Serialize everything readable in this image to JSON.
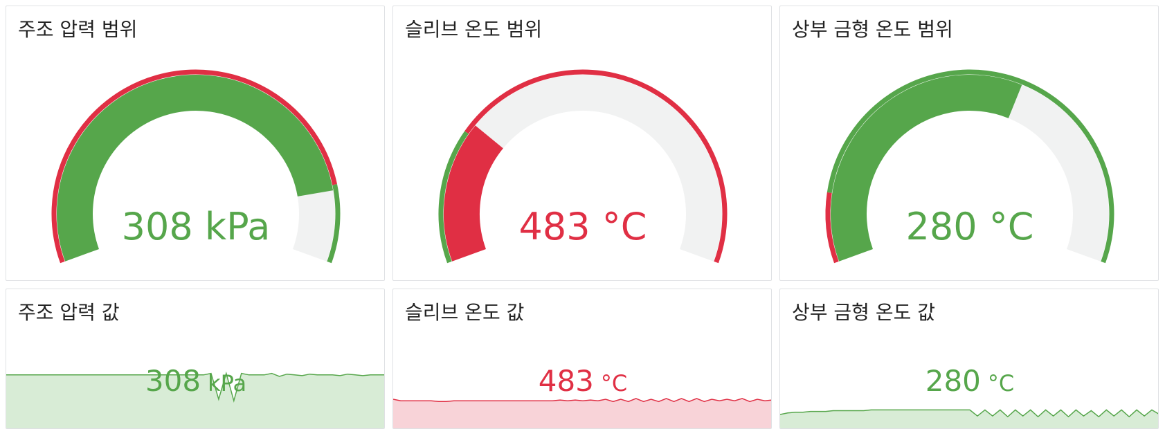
{
  "colors": {
    "green": "#56a64b",
    "red": "#e02f44",
    "track": "#f1f2f2",
    "green_fill": "#d8ecd6",
    "red_fill": "#f8d3d8"
  },
  "gauges": [
    {
      "title": "주조 압력 범위",
      "value_text": "308 kPa",
      "value_color": "#56a64b",
      "fill_color": "#56a64b",
      "fill_fraction": 0.865,
      "threshold_steps": [
        {
          "to": 0.855,
          "color": "#e02f44"
        },
        {
          "to": 1.0,
          "color": "#56a64b"
        }
      ]
    },
    {
      "title": "슬리브 온도 범위",
      "value_text": "483 °C",
      "value_color": "#e02f44",
      "fill_color": "#e02f44",
      "fill_fraction": 0.27,
      "threshold_steps": [
        {
          "to": 0.25,
          "color": "#56a64b"
        },
        {
          "to": 1.0,
          "color": "#e02f44"
        }
      ]
    },
    {
      "title": "상부 금형 온도 범위",
      "value_text": "280 °C",
      "value_color": "#56a64b",
      "fill_color": "#56a64b",
      "fill_fraction": 0.6,
      "threshold_steps": [
        {
          "to": 0.13,
          "color": "#e02f44"
        },
        {
          "to": 1.0,
          "color": "#56a64b"
        }
      ]
    }
  ],
  "sparklines": [
    {
      "title": "주조 압력 값",
      "value_number": "308",
      "value_unit": "kPa",
      "color": "#56a64b",
      "fill": "#d8ecd6",
      "series": [
        0.72,
        0.72,
        0.72,
        0.72,
        0.72,
        0.72,
        0.72,
        0.72,
        0.72,
        0.72,
        0.72,
        0.72,
        0.72,
        0.72,
        0.72,
        0.72,
        0.72,
        0.72,
        0.72,
        0.72,
        0.72,
        0.72,
        0.72,
        0.72,
        0.72,
        0.72,
        0.72,
        0.74,
        0.4,
        0.74,
        0.38,
        0.74,
        0.72,
        0.72,
        0.72,
        0.74,
        0.7,
        0.73,
        0.72,
        0.71,
        0.73,
        0.72,
        0.72,
        0.72,
        0.71,
        0.73,
        0.72,
        0.71,
        0.72,
        0.72,
        0.72
      ]
    },
    {
      "title": "슬리브 온도 값",
      "value_number": "483",
      "value_unit": "°C",
      "color": "#e02f44",
      "fill": "#f8d3d8",
      "series": [
        0.4,
        0.38,
        0.38,
        0.38,
        0.38,
        0.38,
        0.37,
        0.37,
        0.38,
        0.38,
        0.38,
        0.38,
        0.38,
        0.38,
        0.38,
        0.38,
        0.38,
        0.38,
        0.38,
        0.38,
        0.38,
        0.38,
        0.39,
        0.38,
        0.39,
        0.38,
        0.39,
        0.38,
        0.4,
        0.37,
        0.4,
        0.37,
        0.41,
        0.37,
        0.4,
        0.37,
        0.41,
        0.37,
        0.41,
        0.37,
        0.41,
        0.37,
        0.4,
        0.38,
        0.4,
        0.38,
        0.41,
        0.37,
        0.4,
        0.38,
        0.39
      ]
    },
    {
      "title": "상부 금형 온도 값",
      "value_number": "280",
      "value_unit": "°C",
      "color": "#56a64b",
      "fill": "#d8ecd6",
      "series": [
        0.2,
        0.22,
        0.23,
        0.23,
        0.24,
        0.24,
        0.24,
        0.25,
        0.25,
        0.25,
        0.25,
        0.25,
        0.26,
        0.26,
        0.26,
        0.26,
        0.26,
        0.26,
        0.26,
        0.26,
        0.26,
        0.26,
        0.26,
        0.26,
        0.26,
        0.26,
        0.18,
        0.26,
        0.18,
        0.26,
        0.17,
        0.26,
        0.18,
        0.26,
        0.17,
        0.26,
        0.18,
        0.26,
        0.17,
        0.26,
        0.18,
        0.25,
        0.17,
        0.26,
        0.18,
        0.26,
        0.17,
        0.26,
        0.18,
        0.26,
        0.2
      ]
    }
  ]
}
